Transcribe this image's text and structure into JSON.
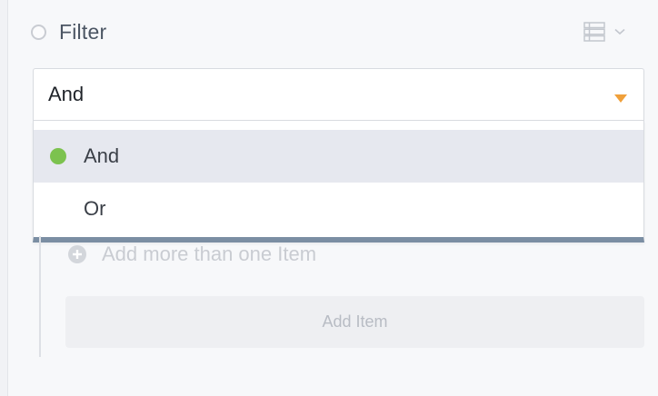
{
  "filter": {
    "title": "Filter",
    "view_icon": "list-view-icon",
    "dropdown_icon": "chevron-down-icon"
  },
  "select": {
    "value": "And",
    "caret_icon": "caret-down-icon",
    "caret_color": "#f0a03a"
  },
  "menu": {
    "options": [
      {
        "label": "And",
        "selected": true
      },
      {
        "label": "Or",
        "selected": false
      }
    ],
    "selected_indicator_color": "#7cc24f",
    "footer_color": "#7b8ea3"
  },
  "add_more": {
    "icon": "plus-circle-icon",
    "label": "Add more than one Item"
  },
  "add_item": {
    "label": "Add Item"
  }
}
